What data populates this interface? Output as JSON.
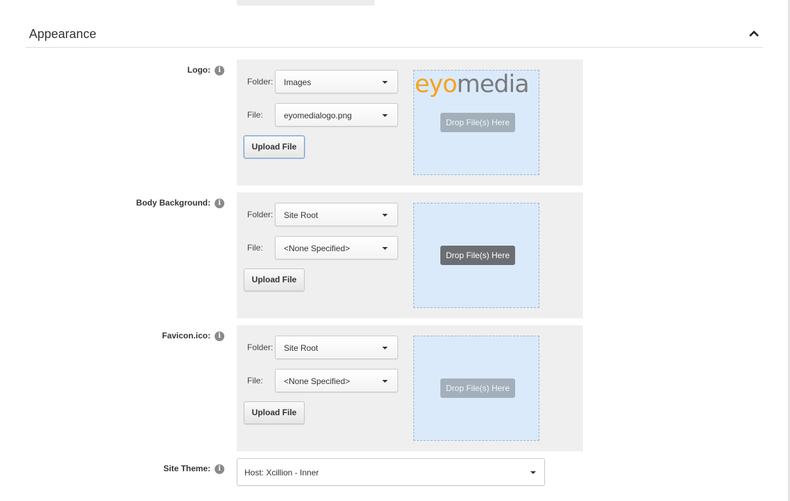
{
  "section": {
    "title": "Appearance"
  },
  "fields": {
    "logo": {
      "label": "Logo:",
      "folder_label": "Folder:",
      "folder_value": "Images",
      "file_label": "File:",
      "file_value": "eyomedialogo.png",
      "upload_label": "Upload File",
      "drop_label": "Drop File(s) Here",
      "preview_logo": {
        "part1": "eyo",
        "part2": "media"
      }
    },
    "body_background": {
      "label": "Body Background:",
      "folder_label": "Folder:",
      "folder_value": "Site Root",
      "file_label": "File:",
      "file_value": "<None Specified>",
      "upload_label": "Upload File",
      "drop_label": "Drop File(s) Here"
    },
    "favicon": {
      "label": "Favicon.ico:",
      "folder_label": "Folder:",
      "folder_value": "Site Root",
      "file_label": "File:",
      "file_value": "<None Specified>",
      "upload_label": "Upload File",
      "drop_label": "Drop File(s) Here"
    },
    "site_theme": {
      "label": "Site Theme:",
      "value": "Host: Xcillion - Inner"
    }
  },
  "icons": {
    "info": "info-icon",
    "collapse": "chevron-up-icon",
    "dropdown": "caret-down-icon"
  },
  "colors": {
    "panel_bg": "#efefef",
    "dropzone_bg": "#daeafb",
    "logo_orange": "#f5a21b",
    "logo_gray": "#7b7b7b"
  }
}
